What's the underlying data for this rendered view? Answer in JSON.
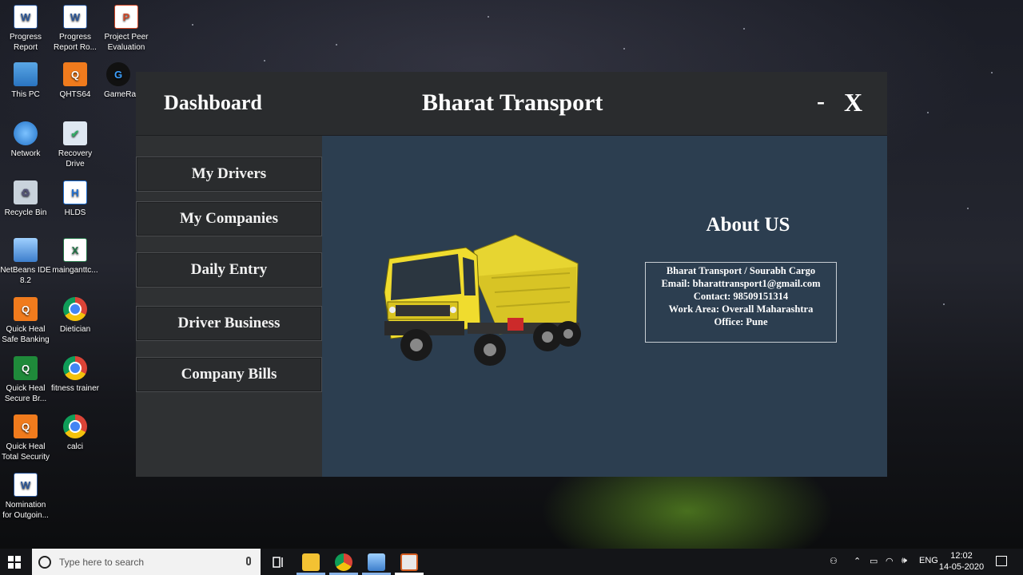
{
  "desktop": {
    "icons": [
      {
        "label": "Progress Report",
        "glyph": "W",
        "kind": "word-icon"
      },
      {
        "label": "Progress Report Ro...",
        "glyph": "W",
        "kind": "word-icon"
      },
      {
        "label": "Project Peer Evaluation",
        "glyph": "P",
        "kind": "powerpoint-icon"
      },
      {
        "label": "This PC",
        "glyph": "",
        "kind": "computer-icon"
      },
      {
        "label": "QHTS64",
        "glyph": "Q",
        "kind": "quickheal-icon"
      },
      {
        "label": "GameRan",
        "glyph": "G",
        "kind": "game-icon"
      },
      {
        "label": "Network",
        "glyph": "",
        "kind": "network-icon"
      },
      {
        "label": "Recovery Drive",
        "glyph": "✔",
        "kind": "recovery-icon"
      },
      {
        "label": "Recycle Bin",
        "glyph": "♻",
        "kind": "recycle-bin-icon"
      },
      {
        "label": "HLDS",
        "glyph": "H",
        "kind": "shortcut-icon"
      },
      {
        "label": "NetBeans IDE 8.2",
        "glyph": "",
        "kind": "netbeans-icon"
      },
      {
        "label": "mainganttc...",
        "glyph": "X",
        "kind": "excel-icon"
      },
      {
        "label": "Quick Heal Safe Banking",
        "glyph": "Q",
        "kind": "quickheal-icon"
      },
      {
        "label": "Dietician",
        "glyph": "",
        "kind": "chrome-icon"
      },
      {
        "label": "Quick Heal Secure Br...",
        "glyph": "Q",
        "kind": "quickheal-icon"
      },
      {
        "label": "fitness trainer",
        "glyph": "",
        "kind": "chrome-icon"
      },
      {
        "label": "Quick Heal Total Security",
        "glyph": "Q",
        "kind": "quickheal-icon"
      },
      {
        "label": "calci",
        "glyph": "",
        "kind": "chrome-icon"
      },
      {
        "label": "Nomination for Outgoin...",
        "glyph": "W",
        "kind": "word-icon"
      }
    ]
  },
  "app": {
    "dashboard_label": "Dashboard",
    "title": "Bharat Transport",
    "minimize_label": "-",
    "close_label": "X",
    "nav": [
      {
        "label": "My Drivers"
      },
      {
        "label": "My Companies"
      },
      {
        "label": "Daily Entry"
      },
      {
        "label": "Driver Business"
      },
      {
        "label": "Company Bills"
      }
    ],
    "about": {
      "title": "About US",
      "lines": [
        "Bharat Transport / Sourabh Cargo",
        "Email: bharattransport1@gmail.com",
        "Contact: 98509151314",
        "Work Area: Overall Maharashtra",
        "Office: Pune"
      ]
    },
    "image": "yellow-dump-truck"
  },
  "taskbar": {
    "search_placeholder": "Type here to search",
    "language": "ENG",
    "time": "12:02",
    "date": "14-05-2020"
  }
}
